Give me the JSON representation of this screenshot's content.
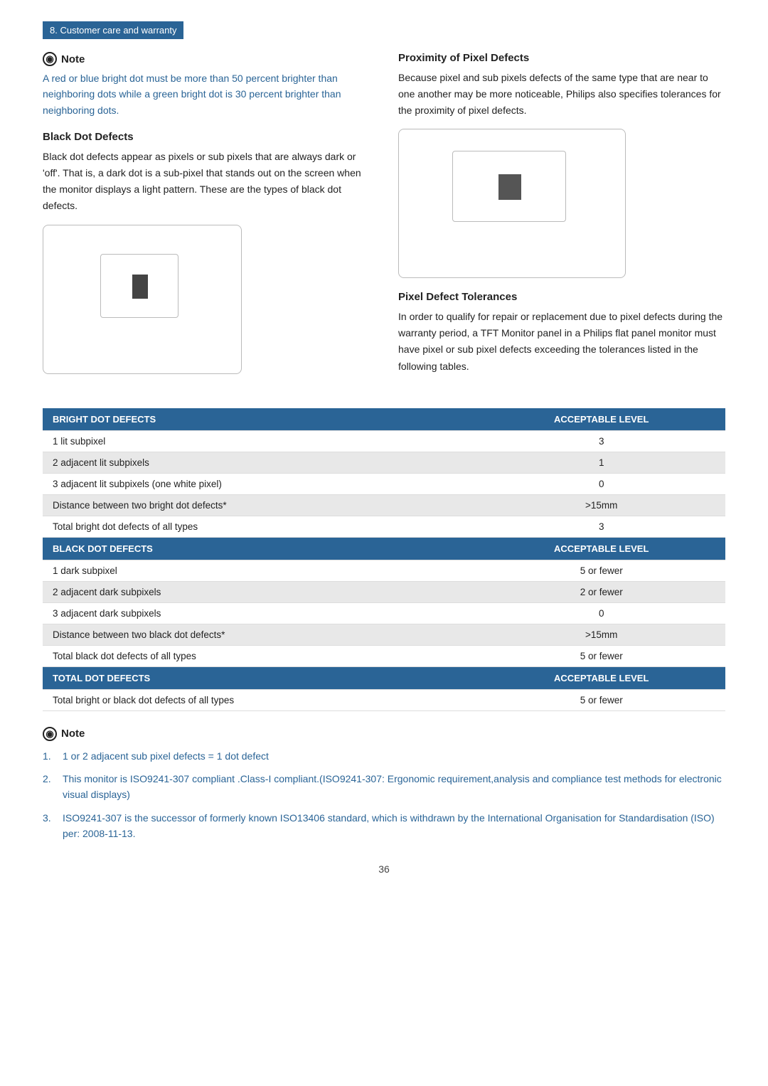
{
  "header": {
    "section_label": "8. Customer care and warranty"
  },
  "note_block": {
    "title": "Note",
    "text": "A red or blue bright dot must be more than 50 percent brighter than neighboring dots while a green bright dot is 30 percent brighter than neighboring dots."
  },
  "black_dot_defects": {
    "heading": "Black Dot Defects",
    "body": "Black dot defects appear as pixels or sub pixels that are always dark or 'off'. That is, a dark dot is a sub-pixel that stands out on the screen when the monitor displays a light pattern. These are the types of black dot defects."
  },
  "proximity": {
    "heading": "Proximity of Pixel Defects",
    "body": "Because pixel and sub pixels defects of the same type that are near to one another may be more noticeable, Philips also specifies tolerances for the proximity of pixel defects."
  },
  "pixel_defect_tolerances": {
    "heading": "Pixel Defect Tolerances",
    "body": "In order to qualify for repair or replacement due to pixel defects during the warranty period, a TFT Monitor panel in a Philips flat panel monitor must have pixel or sub pixel defects exceeding the tolerances listed in the following tables."
  },
  "table": {
    "bright_dot_header": "BRIGHT DOT DEFECTS",
    "acceptable_level_header": "ACCEPTABLE LEVEL",
    "bright_dot_rows": [
      {
        "label": "1 lit subpixel",
        "value": "3",
        "shade": "odd"
      },
      {
        "label": "2 adjacent lit subpixels",
        "value": "1",
        "shade": "even"
      },
      {
        "label": "3 adjacent lit subpixels (one white pixel)",
        "value": "0",
        "shade": "odd"
      },
      {
        "label": "Distance between two bright dot defects*",
        "value": ">15mm",
        "shade": "even"
      },
      {
        "label": "Total bright dot defects of all types",
        "value": "3",
        "shade": "odd"
      }
    ],
    "black_dot_header": "BLACK DOT DEFECTS",
    "black_dot_rows": [
      {
        "label": "1 dark subpixel",
        "value": "5 or fewer",
        "shade": "odd"
      },
      {
        "label": "2 adjacent dark subpixels",
        "value": "2 or fewer",
        "shade": "even"
      },
      {
        "label": "3 adjacent dark subpixels",
        "value": "0",
        "shade": "odd"
      },
      {
        "label": "Distance between two black dot defects*",
        "value": ">15mm",
        "shade": "even"
      },
      {
        "label": "Total black dot defects of all types",
        "value": "5 or fewer",
        "shade": "odd"
      }
    ],
    "total_dot_header": "TOTAL DOT DEFECTS",
    "total_dot_rows": [
      {
        "label": "Total bright or black dot defects of all types",
        "value": "5 or fewer",
        "shade": "odd"
      }
    ]
  },
  "bottom_notes": {
    "title": "Note",
    "items": [
      "1 or 2 adjacent sub pixel defects = 1 dot defect",
      "This monitor is ISO9241-307 compliant .Class-I compliant.(ISO9241-307: Ergonomic requirement,analysis and compliance test methods for electronic visual displays)",
      "ISO9241-307 is the successor of formerly known ISO13406 standard, which is withdrawn by the International Organisation for Standardisation (ISO) per: 2008-11-13."
    ],
    "numbers": [
      "1.",
      "2.",
      "3."
    ]
  },
  "page_number": "36"
}
